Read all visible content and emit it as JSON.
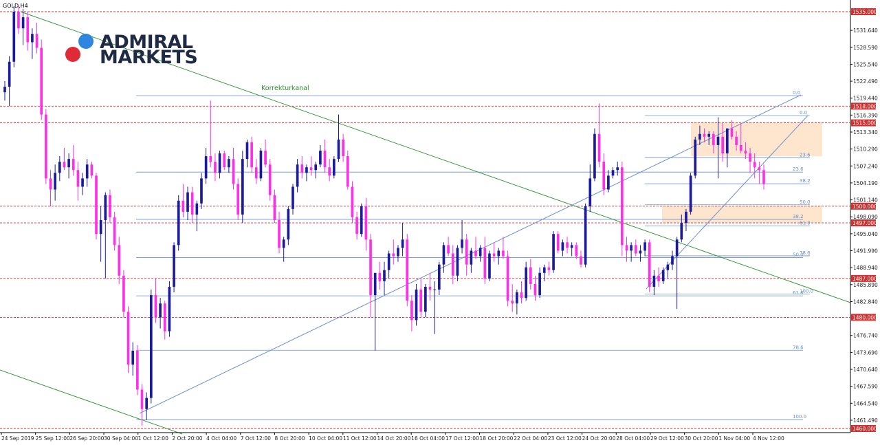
{
  "symbol_label": "GOLD,H4",
  "logo": {
    "line1": "ADMIRAL",
    "line2": "MARKETS",
    "dot_top_color": "#2e86e0",
    "dot_bottom_color": "#e02a36"
  },
  "colors": {
    "bull": "#1a1a9e",
    "bear": "#ff2ee8",
    "level_line": "#d32f2f",
    "fib_line": "#6a8fd0",
    "trend_line": "#3a9a3a",
    "zone_fill": "#fde2c4"
  },
  "chart_data": {
    "type": "candlestick",
    "title": "GOLD,H4",
    "ylim": [
      1457.4,
      1537.6
    ],
    "y_ticks": [
      1531.64,
      1528.59,
      1525.54,
      1522.49,
      1519.44,
      1516.39,
      1513.34,
      1510.29,
      1507.24,
      1504.19,
      1501.14,
      1498.09,
      1495.04,
      1491.99,
      1488.94,
      1485.89,
      1482.84,
      1476.74,
      1473.69,
      1470.64,
      1467.59,
      1464.54,
      1461.49
    ],
    "x_labels": [
      "24 Sep 2019",
      "25 Sep 12:00",
      "26 Sep 20:00",
      "30 Sep 04:00",
      "1 Oct 12:00",
      "2 Oct 20:00",
      "4 Oct 04:00",
      "7 Oct 12:00",
      "8 Oct 20:00",
      "10 Oct 04:00",
      "11 Oct 12:00",
      "14 Oct 20:00",
      "16 Oct 04:00",
      "17 Oct 12:00",
      "18 Oct 20:00",
      "22 Oct 04:00",
      "23 Oct 12:00",
      "24 Oct 20:00",
      "28 Oct 04:00",
      "29 Oct 12:00",
      "30 Oct 20:00",
      "1 Nov 04:00",
      "4 Nov 12:00"
    ],
    "levels": [
      1535.0,
      1518.0,
      1515.0,
      1500.0,
      1497.0,
      1487.0,
      1480.0,
      1460.0
    ],
    "level_labels": [
      "1535.000",
      "1518.000",
      "1515.000",
      "1500.000",
      "1497.000",
      "1487.000",
      "1480.000",
      "1460.000"
    ],
    "fib_sets": [
      {
        "from": 1461.6,
        "to": 1519.9,
        "labels": [
          "0.0",
          "23.6",
          "38.2",
          "50.0",
          "61.8",
          "78.6",
          "100.0"
        ]
      },
      {
        "from": 1484.2,
        "to": 1516.3,
        "labels": [
          "0.0",
          "23.6",
          "38.2",
          "50.0",
          "61.8",
          "78.6",
          "100.0"
        ]
      }
    ],
    "annotation": "Korrekturkanal",
    "zones": [
      {
        "y_from": 1509.0,
        "y_to": 1515.0
      },
      {
        "y_from": 1497.0,
        "y_to": 1500.0
      }
    ],
    "candles": [
      [
        1520.5,
        1522.5,
        1519.0,
        1521.5
      ],
      [
        1521.5,
        1527.0,
        1518.0,
        1526.0
      ],
      [
        1526.0,
        1536.0,
        1525.0,
        1535.0
      ],
      [
        1535.0,
        1536.0,
        1531.0,
        1532.0
      ],
      [
        1532.0,
        1535.5,
        1529.0,
        1534.0
      ],
      [
        1534.0,
        1535.0,
        1528.0,
        1529.5
      ],
      [
        1529.5,
        1532.0,
        1526.5,
        1531.0
      ],
      [
        1531.0,
        1533.0,
        1527.5,
        1528.5
      ],
      [
        1528.5,
        1530.0,
        1515.5,
        1516.5
      ],
      [
        1516.5,
        1517.5,
        1504.0,
        1505.0
      ],
      [
        1505.0,
        1506.5,
        1500.0,
        1503.0
      ],
      [
        1503.0,
        1507.5,
        1501.0,
        1506.0
      ],
      [
        1506.0,
        1509.0,
        1504.5,
        1508.0
      ],
      [
        1508.0,
        1510.5,
        1506.5,
        1507.0
      ],
      [
        1507.0,
        1509.5,
        1505.0,
        1508.5
      ],
      [
        1508.5,
        1511.0,
        1505.5,
        1506.5
      ],
      [
        1506.5,
        1508.0,
        1501.0,
        1503.5
      ],
      [
        1503.5,
        1506.0,
        1502.0,
        1505.0
      ],
      [
        1505.0,
        1508.5,
        1503.5,
        1507.5
      ],
      [
        1507.5,
        1508.0,
        1505.0,
        1505.5
      ],
      [
        1505.5,
        1506.0,
        1494.0,
        1495.0
      ],
      [
        1495.0,
        1500.0,
        1490.0,
        1497.5
      ],
      [
        1497.5,
        1502.5,
        1487.0,
        1502.0
      ],
      [
        1502.0,
        1503.0,
        1497.0,
        1498.0
      ],
      [
        1498.0,
        1499.0,
        1492.0,
        1493.0
      ],
      [
        1493.0,
        1494.5,
        1486.0,
        1487.5
      ],
      [
        1487.5,
        1488.5,
        1480.0,
        1481.0
      ],
      [
        1481.0,
        1482.0,
        1470.0,
        1471.5
      ],
      [
        1471.5,
        1475.5,
        1469.5,
        1474.0
      ],
      [
        1474.0,
        1475.0,
        1466.0,
        1467.0
      ],
      [
        1467.0,
        1468.0,
        1460.5,
        1463.5
      ],
      [
        1463.5,
        1466.5,
        1461.5,
        1465.5
      ],
      [
        1465.5,
        1485.0,
        1464.5,
        1484.0
      ],
      [
        1484.0,
        1487.0,
        1479.0,
        1480.0
      ],
      [
        1480.0,
        1483.5,
        1478.0,
        1482.5
      ],
      [
        1482.5,
        1483.0,
        1476.0,
        1477.5
      ],
      [
        1477.5,
        1486.5,
        1476.5,
        1485.5
      ],
      [
        1485.5,
        1493.5,
        1484.5,
        1493.0
      ],
      [
        1493.0,
        1502.0,
        1492.0,
        1501.0
      ],
      [
        1501.0,
        1504.0,
        1498.0,
        1499.0
      ],
      [
        1499.0,
        1503.5,
        1497.5,
        1502.5
      ],
      [
        1502.5,
        1503.5,
        1497.0,
        1498.5
      ],
      [
        1498.5,
        1501.0,
        1495.5,
        1500.5
      ],
      [
        1500.5,
        1506.0,
        1499.5,
        1505.0
      ],
      [
        1505.0,
        1510.5,
        1504.0,
        1509.0
      ],
      [
        1509.0,
        1519.0,
        1507.0,
        1508.0
      ],
      [
        1508.0,
        1509.5,
        1504.5,
        1506.0
      ],
      [
        1506.0,
        1510.0,
        1505.0,
        1509.5
      ],
      [
        1509.5,
        1510.0,
        1506.5,
        1507.0
      ],
      [
        1507.0,
        1509.0,
        1506.0,
        1508.5
      ],
      [
        1508.5,
        1510.5,
        1503.0,
        1504.0
      ],
      [
        1504.0,
        1505.0,
        1497.5,
        1498.5
      ],
      [
        1498.5,
        1510.0,
        1497.0,
        1508.5
      ],
      [
        1508.5,
        1512.0,
        1507.0,
        1511.5
      ],
      [
        1511.5,
        1512.5,
        1506.0,
        1507.0
      ],
      [
        1507.0,
        1508.5,
        1504.0,
        1505.0
      ],
      [
        1505.0,
        1510.5,
        1504.5,
        1510.0
      ],
      [
        1510.0,
        1512.0,
        1507.0,
        1507.5
      ],
      [
        1507.5,
        1508.5,
        1501.0,
        1502.0
      ],
      [
        1502.0,
        1503.0,
        1497.0,
        1497.5
      ],
      [
        1497.5,
        1499.0,
        1491.5,
        1492.5
      ],
      [
        1492.5,
        1494.5,
        1490.0,
        1494.0
      ],
      [
        1494.0,
        1500.0,
        1493.0,
        1499.5
      ],
      [
        1499.5,
        1504.0,
        1498.5,
        1503.5
      ],
      [
        1503.5,
        1508.5,
        1502.5,
        1507.5
      ],
      [
        1507.5,
        1509.0,
        1505.0,
        1506.0
      ],
      [
        1506.0,
        1507.5,
        1504.5,
        1507.0
      ],
      [
        1507.0,
        1509.0,
        1505.5,
        1506.5
      ],
      [
        1506.5,
        1508.0,
        1505.0,
        1507.5
      ],
      [
        1507.5,
        1511.0,
        1507.0,
        1510.0
      ],
      [
        1510.0,
        1512.0,
        1506.0,
        1507.0
      ],
      [
        1507.0,
        1508.5,
        1504.5,
        1505.5
      ],
      [
        1505.5,
        1509.0,
        1505.0,
        1508.5
      ],
      [
        1508.5,
        1516.5,
        1508.0,
        1512.0
      ],
      [
        1512.0,
        1513.0,
        1508.0,
        1509.0
      ],
      [
        1509.0,
        1510.0,
        1503.0,
        1503.5
      ],
      [
        1503.5,
        1504.5,
        1497.0,
        1498.0
      ],
      [
        1498.0,
        1499.0,
        1494.0,
        1495.0
      ],
      [
        1495.0,
        1500.5,
        1494.5,
        1500.0
      ],
      [
        1500.0,
        1501.5,
        1492.0,
        1494.0
      ],
      [
        1494.0,
        1495.0,
        1480.0,
        1484.0
      ],
      [
        1484.0,
        1486.0,
        1474.0,
        1488.0
      ],
      [
        1488.0,
        1490.0,
        1485.0,
        1486.5
      ],
      [
        1486.5,
        1490.0,
        1484.0,
        1488.5
      ],
      [
        1488.5,
        1492.0,
        1487.0,
        1491.5
      ],
      [
        1491.5,
        1494.0,
        1489.5,
        1491.0
      ],
      [
        1491.0,
        1493.0,
        1490.0,
        1492.5
      ],
      [
        1492.5,
        1497.0,
        1491.0,
        1494.0
      ],
      [
        1494.0,
        1495.0,
        1482.0,
        1483.0
      ],
      [
        1483.0,
        1484.0,
        1477.5,
        1479.5
      ],
      [
        1479.5,
        1486.0,
        1478.5,
        1485.0
      ],
      [
        1485.0,
        1487.0,
        1480.0,
        1481.0
      ],
      [
        1481.0,
        1486.0,
        1480.0,
        1485.5
      ],
      [
        1485.5,
        1488.0,
        1483.0,
        1485.0
      ],
      [
        1485.0,
        1486.5,
        1477.0,
        1485.0
      ],
      [
        1485.0,
        1490.0,
        1484.0,
        1489.5
      ],
      [
        1489.5,
        1493.5,
        1488.0,
        1493.0
      ],
      [
        1493.0,
        1494.5,
        1491.0,
        1491.5
      ],
      [
        1491.5,
        1493.0,
        1486.0,
        1487.5
      ],
      [
        1487.5,
        1493.0,
        1486.5,
        1492.5
      ],
      [
        1492.5,
        1497.5,
        1491.5,
        1494.0
      ],
      [
        1494.0,
        1495.0,
        1487.5,
        1489.5
      ],
      [
        1489.5,
        1492.5,
        1488.0,
        1492.0
      ],
      [
        1492.0,
        1494.5,
        1490.5,
        1491.0
      ],
      [
        1491.0,
        1493.0,
        1490.0,
        1492.5
      ],
      [
        1492.5,
        1494.5,
        1486.0,
        1487.0
      ],
      [
        1487.0,
        1492.0,
        1486.5,
        1491.5
      ],
      [
        1491.5,
        1493.5,
        1490.0,
        1491.0
      ],
      [
        1491.0,
        1492.5,
        1489.5,
        1492.0
      ],
      [
        1492.0,
        1494.5,
        1490.5,
        1491.0
      ],
      [
        1491.0,
        1492.0,
        1482.0,
        1483.0
      ],
      [
        1483.0,
        1486.0,
        1481.0,
        1482.5
      ],
      [
        1482.5,
        1485.0,
        1480.5,
        1484.5
      ],
      [
        1484.5,
        1486.5,
        1482.5,
        1483.5
      ],
      [
        1483.5,
        1490.0,
        1483.0,
        1489.0
      ],
      [
        1489.0,
        1490.5,
        1485.0,
        1486.0
      ],
      [
        1486.0,
        1487.5,
        1483.0,
        1484.0
      ],
      [
        1484.0,
        1489.0,
        1483.5,
        1488.0
      ],
      [
        1488.0,
        1489.5,
        1486.5,
        1489.0
      ],
      [
        1489.0,
        1490.0,
        1487.5,
        1488.5
      ],
      [
        1488.5,
        1495.5,
        1488.0,
        1495.0
      ],
      [
        1495.0,
        1495.5,
        1491.5,
        1492.0
      ],
      [
        1492.0,
        1494.0,
        1491.0,
        1493.5
      ],
      [
        1493.5,
        1494.5,
        1491.5,
        1492.5
      ],
      [
        1492.5,
        1493.5,
        1491.0,
        1493.0
      ],
      [
        1493.0,
        1493.5,
        1490.5,
        1491.0
      ],
      [
        1491.0,
        1492.0,
        1489.0,
        1489.5
      ],
      [
        1489.5,
        1500.5,
        1489.0,
        1500.0
      ],
      [
        1500.0,
        1507.5,
        1499.0,
        1505.0
      ],
      [
        1505.0,
        1514.0,
        1504.5,
        1513.0
      ],
      [
        1513.0,
        1518.5,
        1507.0,
        1508.0
      ],
      [
        1508.0,
        1509.5,
        1502.0,
        1503.0
      ],
      [
        1503.0,
        1506.5,
        1502.5,
        1505.5
      ],
      [
        1505.5,
        1507.0,
        1505.0,
        1506.5
      ],
      [
        1506.5,
        1508.0,
        1505.5,
        1507.0
      ],
      [
        1507.0,
        1508.0,
        1491.0,
        1493.0
      ],
      [
        1493.0,
        1494.5,
        1490.0,
        1492.0
      ],
      [
        1492.0,
        1493.5,
        1490.0,
        1493.0
      ],
      [
        1493.0,
        1494.0,
        1491.0,
        1491.5
      ],
      [
        1491.5,
        1493.0,
        1490.0,
        1492.0
      ],
      [
        1492.0,
        1494.0,
        1491.0,
        1493.5
      ],
      [
        1493.5,
        1494.0,
        1484.5,
        1485.5
      ],
      [
        1485.5,
        1488.5,
        1484.0,
        1487.5
      ],
      [
        1487.5,
        1489.0,
        1485.5,
        1486.5
      ],
      [
        1486.5,
        1489.0,
        1486.0,
        1488.5
      ],
      [
        1488.5,
        1490.0,
        1487.0,
        1489.5
      ],
      [
        1489.5,
        1492.0,
        1488.5,
        1491.0
      ],
      [
        1491.0,
        1494.5,
        1481.5,
        1494.0
      ],
      [
        1494.0,
        1498.5,
        1493.5,
        1497.0
      ],
      [
        1497.0,
        1499.5,
        1495.5,
        1499.0
      ],
      [
        1499.0,
        1506.0,
        1498.5,
        1505.5
      ],
      [
        1505.5,
        1512.5,
        1505.0,
        1512.0
      ],
      [
        1512.0,
        1514.5,
        1511.0,
        1513.0
      ],
      [
        1513.0,
        1514.0,
        1511.5,
        1512.5
      ],
      [
        1512.5,
        1513.5,
        1511.0,
        1513.0
      ],
      [
        1513.0,
        1513.5,
        1509.5,
        1511.0
      ],
      [
        1511.0,
        1516.0,
        1505.0,
        1512.5
      ],
      [
        1512.5,
        1515.0,
        1508.0,
        1509.5
      ],
      [
        1509.5,
        1512.0,
        1507.0,
        1514.0
      ],
      [
        1514.0,
        1515.5,
        1512.0,
        1512.5
      ],
      [
        1512.5,
        1513.5,
        1510.0,
        1511.0
      ],
      [
        1511.0,
        1515.0,
        1509.5,
        1510.0
      ],
      [
        1510.0,
        1511.5,
        1508.5,
        1509.5
      ],
      [
        1509.5,
        1510.5,
        1506.0,
        1508.0
      ],
      [
        1508.0,
        1509.5,
        1505.0,
        1507.0
      ],
      [
        1507.0,
        1508.0,
        1504.0,
        1506.5
      ],
      [
        1506.5,
        1507.5,
        1503.0,
        1504.0
      ]
    ]
  }
}
